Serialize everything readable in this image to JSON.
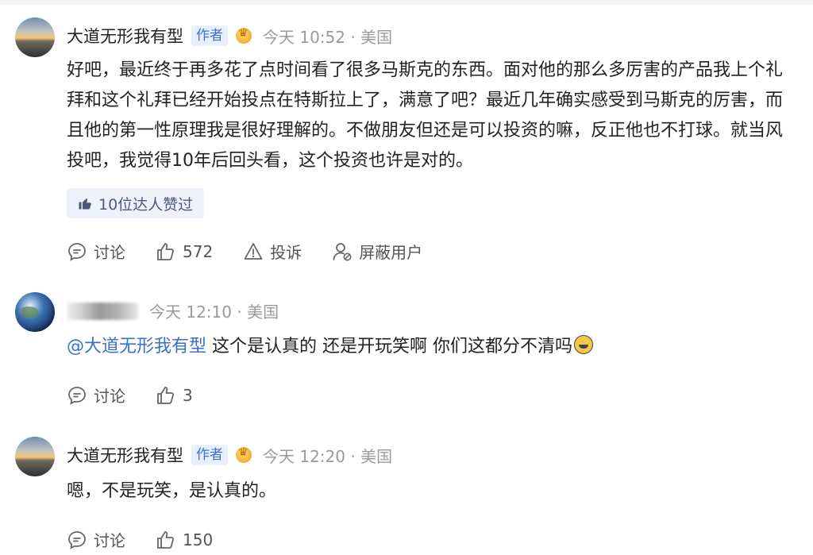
{
  "comments": [
    {
      "username": "大道无形我有型",
      "author_badge": "作者",
      "time": "今天 10:52 · 美国",
      "text": "好吧，最近终于再多花了点时间看了很多马斯克的东西。面对他的那么多厉害的产品我上个礼拜和这个礼拜已经开始投点在特斯拉上了，满意了吧？最近几年确实感受到马斯克的厉害，而且他的第一性原理我是很好理解的。不做朋友但还是可以投资的嘛，反正他也不打球。就当风投吧，我觉得10年后回头看，这个投资也许是对的。",
      "likers_label": "10位达人赞过",
      "discuss_label": "讨论",
      "like_count": "572",
      "report_label": "投诉",
      "block_label": "屏蔽用户"
    },
    {
      "time": "今天 12:10 · 美国",
      "mention": "@大道无形我有型",
      "text": " 这个是认真的 还是开玩笑啊 你们这都分不清吗",
      "discuss_label": "讨论",
      "like_count": "3"
    },
    {
      "username": "大道无形我有型",
      "author_badge": "作者",
      "time": "今天 12:20 · 美国",
      "text": "嗯，不是玩笑，是认真的。",
      "discuss_label": "讨论",
      "like_count": "150"
    }
  ],
  "icons": {
    "discuss": "chat-bubble-icon",
    "like": "thumbs-up-icon",
    "report": "warning-triangle-icon",
    "block": "person-block-icon",
    "crown": "crown-badge-icon",
    "emoji": "laughing-emoji-icon"
  },
  "colors": {
    "accent": "#3a6fcc",
    "muted": "#9a9a9a"
  }
}
